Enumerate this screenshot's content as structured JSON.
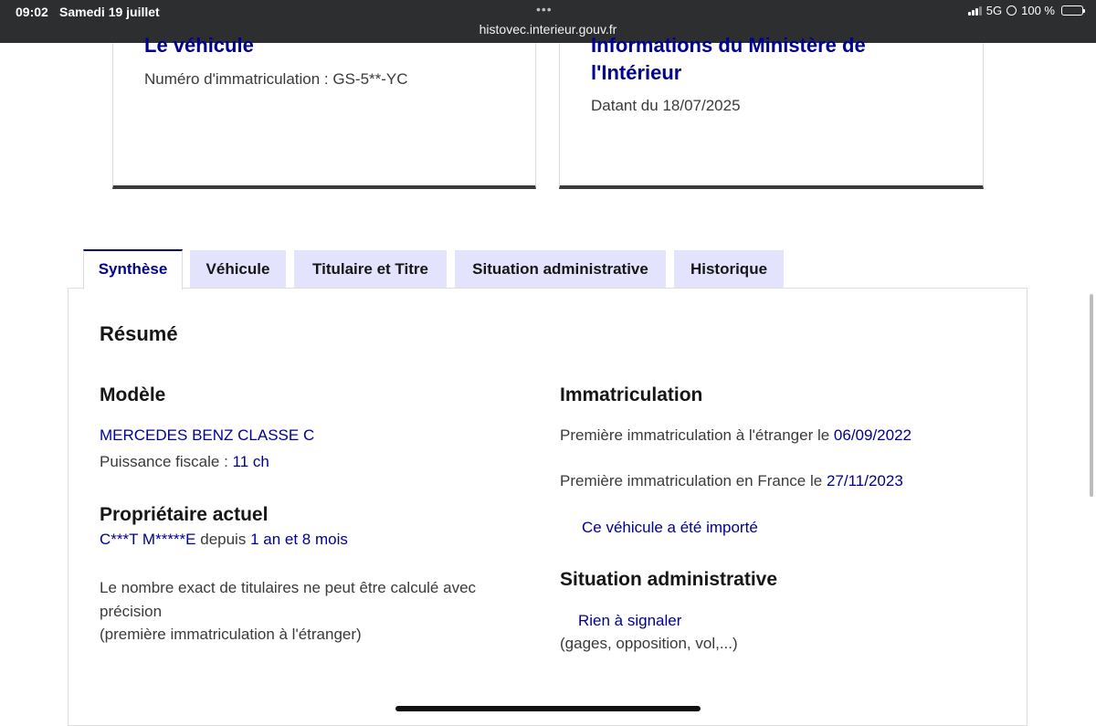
{
  "status_bar": {
    "time": "09:02",
    "date": "Samedi 19 juillet",
    "dots": "•••",
    "url": "histovec.interieur.gouv.fr",
    "network": "5G",
    "battery": "100 %"
  },
  "cards": {
    "vehicle": {
      "title": "Le véhicule",
      "plate_text": "Numéro d'immatriculation : GS-5**-YC"
    },
    "ministry": {
      "title_line1": "Informations du Ministère de",
      "title_line2": "l'Intérieur",
      "date_text": "Datant du 18/07/2025"
    }
  },
  "tabs": [
    {
      "label": "Synthèse",
      "active": true
    },
    {
      "label": "Véhicule",
      "active": false
    },
    {
      "label": "Titulaire et Titre",
      "active": false
    },
    {
      "label": "Situation administrative",
      "active": false
    },
    {
      "label": "Historique",
      "active": false
    }
  ],
  "summary": {
    "heading": "Résumé",
    "model": {
      "heading": "Modèle",
      "name": "MERCEDES BENZ CLASSE C",
      "power_label": "Puissance fiscale : ",
      "power_value": "11 ch"
    },
    "owner": {
      "heading": "Propriétaire actuel",
      "name": "C***T M*****E",
      "since_label": " depuis ",
      "duration": "1 an et 8 mois",
      "note_line1": "Le nombre exact de titulaires ne peut être calculé avec",
      "note_line2": "précision",
      "note_line3": "(première immatriculation à l'étranger)"
    },
    "registration": {
      "heading": "Immatriculation",
      "foreign_label": "Première immatriculation à l'étranger le ",
      "foreign_date": "06/09/2022",
      "france_label": "Première immatriculation en France le ",
      "france_date": "27/11/2023",
      "imported": "Ce véhicule a été importé"
    },
    "admin": {
      "heading": "Situation administrative",
      "status": "Rien à signaler",
      "details": "(gages, opposition, vol,...)"
    }
  },
  "colors": {
    "brand_blue": "#000091",
    "tab_inactive_bg": "#e3e3fd",
    "status_bar_bg": "#2d2e2f",
    "text": "#3a3a3a"
  }
}
